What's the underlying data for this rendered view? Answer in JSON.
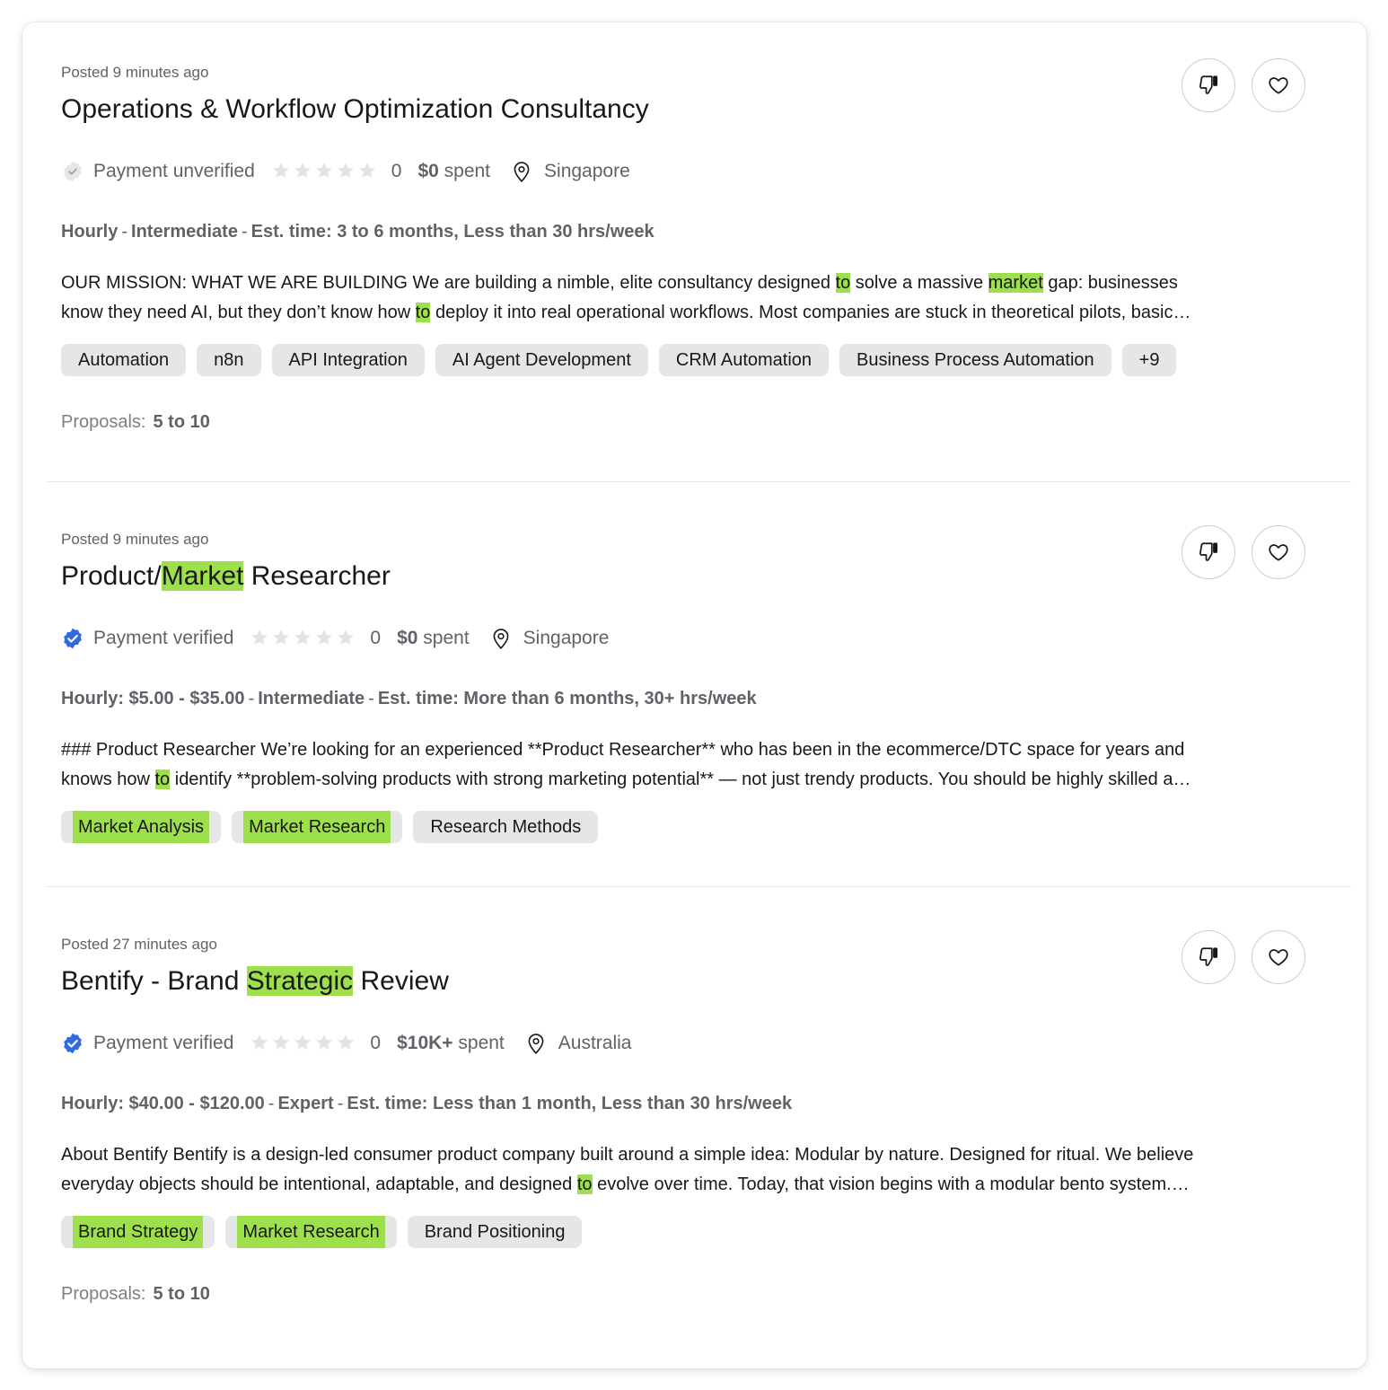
{
  "jobs": [
    {
      "posted": "Posted 9 minutes ago",
      "title_parts": [
        {
          "t": "Operations & Workflow Optimization Consultancy",
          "h": false
        }
      ],
      "payment_label": "Payment unverified",
      "payment_verified": false,
      "rating": "0",
      "spent_amount": "$0",
      "spent_suffix": " spent",
      "location": "Singapore",
      "terms": [
        "Hourly",
        "Intermediate",
        "Est. time: 3 to 6 months, Less than 30 hrs/week"
      ],
      "desc_lines": [
        [
          {
            "t": "OUR MISSION: WHAT WE ARE BUILDING We are building a nimble, elite consultancy designed ",
            "h": false
          },
          {
            "t": "to",
            "h": true
          },
          {
            "t": " solve a massive ",
            "h": false
          },
          {
            "t": "market",
            "h": true
          },
          {
            "t": " gap: businesses",
            "h": false
          }
        ],
        [
          {
            "t": "know they need AI, but they don’t know how ",
            "h": false
          },
          {
            "t": "to",
            "h": true
          },
          {
            "t": " deploy it into real operational workflows. Most companies are stuck in theoretical pilots, basic…",
            "h": false
          }
        ]
      ],
      "tags": [
        {
          "label": "Automation",
          "h": false
        },
        {
          "label": "n8n",
          "h": false
        },
        {
          "label": "API Integration",
          "h": false
        },
        {
          "label": "AI Agent Development",
          "h": false
        },
        {
          "label": "CRM Automation",
          "h": false
        },
        {
          "label": "Business Process Automation",
          "h": false
        },
        {
          "label": "+9",
          "h": false
        }
      ],
      "proposals_label": "Proposals:",
      "proposals_value": "5 to 10"
    },
    {
      "posted": "Posted 9 minutes ago",
      "title_parts": [
        {
          "t": "Product/",
          "h": false
        },
        {
          "t": "Market",
          "h": true
        },
        {
          "t": " Researcher",
          "h": false
        }
      ],
      "payment_label": "Payment verified",
      "payment_verified": true,
      "rating": "0",
      "spent_amount": "$0",
      "spent_suffix": " spent",
      "location": "Singapore",
      "terms": [
        "Hourly: $5.00 - $35.00",
        "Intermediate",
        "Est. time: More than 6 months, 30+ hrs/week"
      ],
      "desc_lines": [
        [
          {
            "t": "### Product Researcher We’re looking for an experienced **Product Researcher** who has been in the ecommerce/DTC space for years and",
            "h": false
          }
        ],
        [
          {
            "t": "knows how ",
            "h": false
          },
          {
            "t": "to",
            "h": true
          },
          {
            "t": " identify **problem-solving products with strong marketing potential** — not just trendy products. You should be highly skilled a…",
            "h": false
          }
        ]
      ],
      "tags": [
        {
          "label": "Market Analysis",
          "h": true
        },
        {
          "label": "Market Research",
          "h": true
        },
        {
          "label": "Research Methods",
          "h": false
        }
      ],
      "proposals_label": "",
      "proposals_value": ""
    },
    {
      "posted": "Posted 27 minutes ago",
      "title_parts": [
        {
          "t": "Bentify - Brand ",
          "h": false
        },
        {
          "t": "Strategic",
          "h": true
        },
        {
          "t": " Review",
          "h": false
        }
      ],
      "payment_label": "Payment verified",
      "payment_verified": true,
      "rating": "0",
      "spent_amount": "$10K+",
      "spent_suffix": " spent",
      "location": "Australia",
      "terms": [
        "Hourly: $40.00 - $120.00",
        "Expert",
        "Est. time: Less than 1 month, Less than 30 hrs/week"
      ],
      "desc_lines": [
        [
          {
            "t": "About Bentify Bentify is a design-led consumer product company built around a simple idea: Modular by nature. Designed for ritual. We believe",
            "h": false
          }
        ],
        [
          {
            "t": "everyday objects should be intentional, adaptable, and designed ",
            "h": false
          },
          {
            "t": "to",
            "h": true
          },
          {
            "t": " evolve over time. Today, that vision begins with a modular bento system.…",
            "h": false
          }
        ]
      ],
      "tags": [
        {
          "label": "Brand Strategy",
          "h": true
        },
        {
          "label": "Market Research",
          "h": true
        },
        {
          "label": "Brand Positioning",
          "h": false
        }
      ],
      "proposals_label": "Proposals:",
      "proposals_value": "5 to 10"
    }
  ],
  "colors": {
    "highlight": "#9ee04b",
    "verified": "#2f6bde",
    "tag_bg": "#e4e6e8",
    "star": "#e1e3e6"
  },
  "icons": {
    "dislike": "thumbs-down-icon",
    "save": "heart-icon",
    "verified": "verified-badge-icon",
    "unverified": "unverified-badge-icon",
    "star": "star-icon",
    "location": "location-pin-icon"
  }
}
